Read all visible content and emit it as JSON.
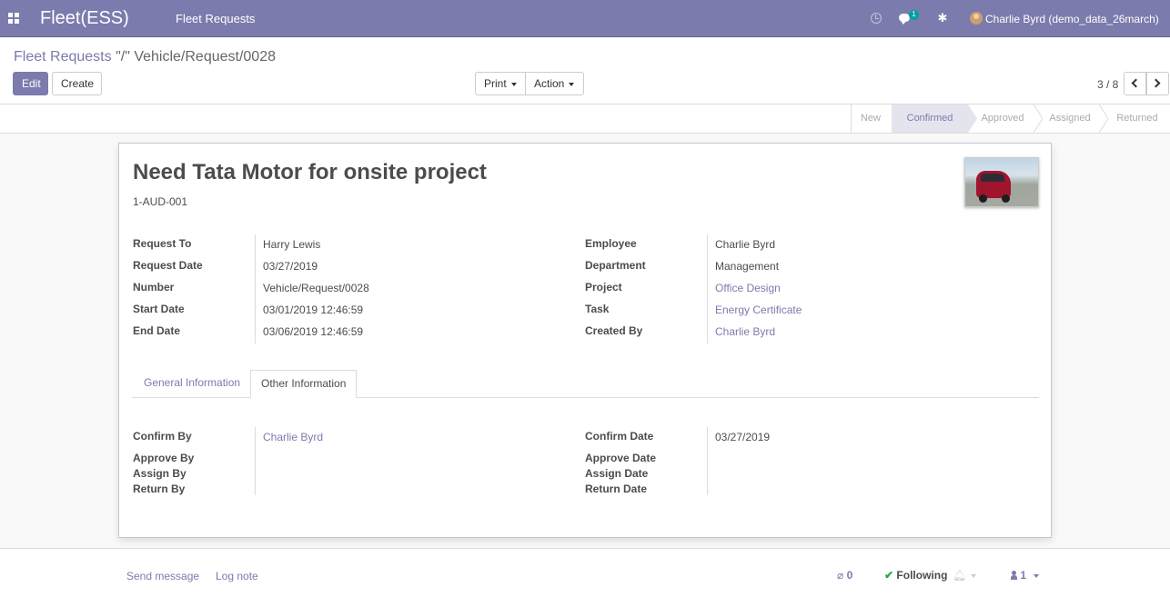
{
  "navbar": {
    "brand": "Fleet(ESS)",
    "menu": "Fleet Requests",
    "chat_badge": "1",
    "user": "Charlie Byrd (demo_data_26march)",
    "icons": [
      "apps-icon",
      "clock-icon",
      "chat-icon",
      "bug-icon",
      "avatar"
    ]
  },
  "breadcrumb": {
    "parent": "Fleet Requests",
    "separator": "\"/\"",
    "current": "Vehicle/Request/0028"
  },
  "buttons": {
    "edit": "Edit",
    "create": "Create",
    "print": "Print",
    "action": "Action"
  },
  "pager": {
    "value": "3 / 8"
  },
  "statusbar": {
    "stages": [
      "New",
      "Confirmed",
      "Approved",
      "Assigned",
      "Returned"
    ],
    "active": "Confirmed"
  },
  "record": {
    "title": "Need Tata Motor for onsite project",
    "code": "1-AUD-001"
  },
  "left_fields": [
    {
      "label": "Request To",
      "value": "Harry Lewis"
    },
    {
      "label": "Request Date",
      "value": "03/27/2019"
    },
    {
      "label": "Number",
      "value": "Vehicle/Request/0028"
    },
    {
      "label": "Start Date",
      "value": "03/01/2019 12:46:59"
    },
    {
      "label": "End Date",
      "value": "03/06/2019 12:46:59"
    }
  ],
  "right_fields": [
    {
      "label": "Employee",
      "value": "Charlie Byrd"
    },
    {
      "label": "Department",
      "value": "Management"
    },
    {
      "label": "Project",
      "value": "Office Design"
    },
    {
      "label": "Task",
      "value": "Energy Certificate"
    },
    {
      "label": "Created By",
      "value": "Charlie Byrd"
    }
  ],
  "tabs": [
    "General Information",
    "Other Information"
  ],
  "active_tab": "Other Information",
  "other_left": [
    {
      "label": "Confirm By",
      "value": "Charlie Byrd"
    },
    {
      "label": "Approve By",
      "value": ""
    },
    {
      "label": "Assign By",
      "value": ""
    },
    {
      "label": "Return By",
      "value": ""
    }
  ],
  "other_right": [
    {
      "label": "Confirm Date",
      "value": "03/27/2019"
    },
    {
      "label": "Approve Date",
      "value": ""
    },
    {
      "label": "Assign Date",
      "value": ""
    },
    {
      "label": "Return Date",
      "value": ""
    }
  ],
  "chatter": {
    "send_message": "Send message",
    "log_note": "Log note",
    "attachments": "0",
    "following": "Following",
    "followers": "1"
  },
  "colors": {
    "brand": "#7c7bad",
    "text": "#4c4c4c",
    "following_check": "#28a745"
  }
}
